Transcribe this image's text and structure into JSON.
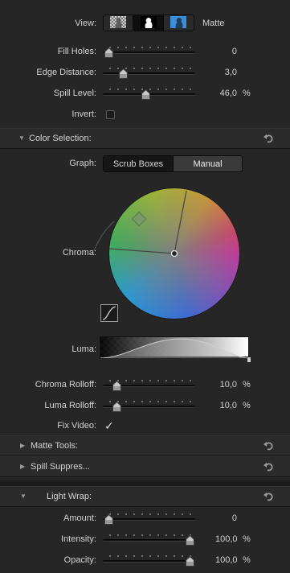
{
  "view": {
    "label": "View:",
    "mode_label": "Matte",
    "buttons": [
      "composite-view-icon",
      "matte-view-icon",
      "keyed-view-icon"
    ],
    "selected_index": 1
  },
  "params": [
    {
      "label": "Fill Holes:",
      "value": "0",
      "unit": "",
      "level": 0.0
    },
    {
      "label": "Edge Distance:",
      "value": "3,0",
      "unit": "",
      "level": 0.18
    },
    {
      "label": "Spill Level:",
      "value": "46,0",
      "unit": "%",
      "level": 0.46
    }
  ],
  "invert": {
    "label": "Invert:",
    "checked": false
  },
  "color_selection": {
    "title": "Color Selection:",
    "graph_label": "Graph:",
    "graph_options": [
      "Scrub Boxes",
      "Manual"
    ],
    "graph_selected": 1,
    "chroma_label": "Chroma:",
    "luma_label": "Luma:"
  },
  "rolloffs": [
    {
      "label": "Chroma Rolloff:",
      "value": "10,0",
      "unit": "%",
      "level": 0.1
    },
    {
      "label": "Luma Rolloff:",
      "value": "10,0",
      "unit": "%",
      "level": 0.1
    }
  ],
  "fix_video": {
    "label": "Fix Video:",
    "checked": true,
    "glyph": "✓"
  },
  "sections": [
    {
      "title": "Matte Tools:",
      "expanded": false
    },
    {
      "title": "Spill Suppres...",
      "expanded": false
    },
    {
      "title": "Light Wrap:",
      "expanded": true
    }
  ],
  "light_wrap": [
    {
      "label": "Amount:",
      "value": "0",
      "unit": "",
      "level": 0.0
    },
    {
      "label": "Intensity:",
      "value": "100,0",
      "unit": "%",
      "level": 1.0
    },
    {
      "label": "Opacity:",
      "value": "100,0",
      "unit": "%",
      "level": 1.0
    }
  ],
  "colors": {
    "accent": "#3a8fd8",
    "background": "#262626"
  }
}
